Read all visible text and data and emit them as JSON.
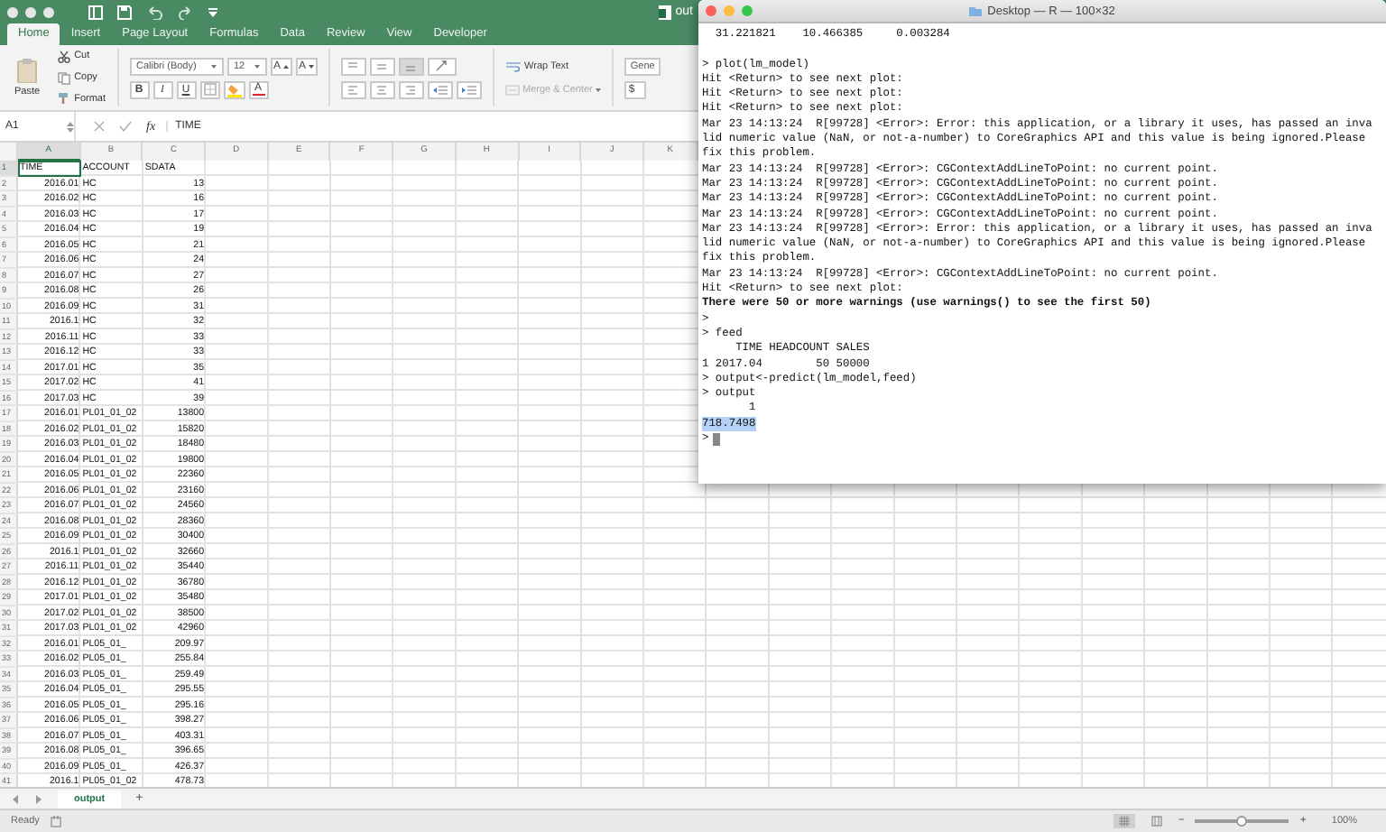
{
  "excel": {
    "title": "out",
    "tabs": [
      {
        "label": "Home",
        "selected": true
      },
      {
        "label": "Insert",
        "selected": false
      },
      {
        "label": "Page Layout",
        "selected": false
      },
      {
        "label": "Formulas",
        "selected": false
      },
      {
        "label": "Data",
        "selected": false
      },
      {
        "label": "Review",
        "selected": false
      },
      {
        "label": "View",
        "selected": false
      },
      {
        "label": "Developer",
        "selected": false
      }
    ],
    "ribbon": {
      "paste": "Paste",
      "cut": "Cut",
      "copy": "Copy",
      "format": "Format",
      "font_name": "Calibri (Body)",
      "font_size": "12",
      "grow_font": "A",
      "shrink_font": "A",
      "bold": "B",
      "italic": "I",
      "underline": "U",
      "font_color": "A",
      "wrap_text": "Wrap Text",
      "merge_center": "Merge & Center",
      "number_format": "Gene",
      "currency": "$"
    },
    "formula_bar": {
      "cell_ref": "A1",
      "fx": "fx",
      "value": "TIME"
    },
    "columns": [
      {
        "label": "A",
        "kind": "number",
        "selected": true
      },
      {
        "label": "B",
        "kind": "text",
        "selected": false
      },
      {
        "label": "C",
        "kind": "number",
        "selected": false
      },
      {
        "label": "D",
        "kind": "text",
        "selected": false
      },
      {
        "label": "E",
        "kind": "text",
        "selected": false
      },
      {
        "label": "F",
        "kind": "text",
        "selected": false
      },
      {
        "label": "G",
        "kind": "text",
        "selected": false
      },
      {
        "label": "H",
        "kind": "text",
        "selected": false
      },
      {
        "label": "I",
        "kind": "text",
        "selected": false
      },
      {
        "label": "J",
        "kind": "text",
        "selected": false
      },
      {
        "label": "K",
        "kind": "text",
        "selected": false
      }
    ],
    "rows": [
      {
        "number": "1",
        "kind": "header",
        "selected": true,
        "cells": [
          "TIME",
          "ACCOUNT",
          "SDATA"
        ]
      },
      {
        "number": "2",
        "kind": "data",
        "selected": false,
        "cells": [
          "2016.01",
          "HC",
          "13"
        ]
      },
      {
        "number": "3",
        "kind": "data",
        "selected": false,
        "cells": [
          "2016.02",
          "HC",
          "16"
        ]
      },
      {
        "number": "4",
        "kind": "data",
        "selected": false,
        "cells": [
          "2016.03",
          "HC",
          "17"
        ]
      },
      {
        "number": "5",
        "kind": "data",
        "selected": false,
        "cells": [
          "2016.04",
          "HC",
          "19"
        ]
      },
      {
        "number": "6",
        "kind": "data",
        "selected": false,
        "cells": [
          "2016.05",
          "HC",
          "21"
        ]
      },
      {
        "number": "7",
        "kind": "data",
        "selected": false,
        "cells": [
          "2016.06",
          "HC",
          "24"
        ]
      },
      {
        "number": "8",
        "kind": "data",
        "selected": false,
        "cells": [
          "2016.07",
          "HC",
          "27"
        ]
      },
      {
        "number": "9",
        "kind": "data",
        "selected": false,
        "cells": [
          "2016.08",
          "HC",
          "26"
        ]
      },
      {
        "number": "10",
        "kind": "data",
        "selected": false,
        "cells": [
          "2016.09",
          "HC",
          "31"
        ]
      },
      {
        "number": "11",
        "kind": "data",
        "selected": false,
        "cells": [
          "2016.1",
          "HC",
          "32"
        ]
      },
      {
        "number": "12",
        "kind": "data",
        "selected": false,
        "cells": [
          "2016.11",
          "HC",
          "33"
        ]
      },
      {
        "number": "13",
        "kind": "data",
        "selected": false,
        "cells": [
          "2016.12",
          "HC",
          "33"
        ]
      },
      {
        "number": "14",
        "kind": "data",
        "selected": false,
        "cells": [
          "2017.01",
          "HC",
          "35"
        ]
      },
      {
        "number": "15",
        "kind": "data",
        "selected": false,
        "cells": [
          "2017.02",
          "HC",
          "41"
        ]
      },
      {
        "number": "16",
        "kind": "data",
        "selected": false,
        "cells": [
          "2017.03",
          "HC",
          "39"
        ]
      },
      {
        "number": "17",
        "kind": "data",
        "selected": false,
        "cells": [
          "2016.01",
          "PL01_01_02",
          "13800"
        ]
      },
      {
        "number": "18",
        "kind": "data",
        "selected": false,
        "cells": [
          "2016.02",
          "PL01_01_02",
          "15820"
        ]
      },
      {
        "number": "19",
        "kind": "data",
        "selected": false,
        "cells": [
          "2016.03",
          "PL01_01_02",
          "18480"
        ]
      },
      {
        "number": "20",
        "kind": "data",
        "selected": false,
        "cells": [
          "2016.04",
          "PL01_01_02",
          "19800"
        ]
      },
      {
        "number": "21",
        "kind": "data",
        "selected": false,
        "cells": [
          "2016.05",
          "PL01_01_02",
          "22360"
        ]
      },
      {
        "number": "22",
        "kind": "data",
        "selected": false,
        "cells": [
          "2016.06",
          "PL01_01_02",
          "23160"
        ]
      },
      {
        "number": "23",
        "kind": "data",
        "selected": false,
        "cells": [
          "2016.07",
          "PL01_01_02",
          "24560"
        ]
      },
      {
        "number": "24",
        "kind": "data",
        "selected": false,
        "cells": [
          "2016.08",
          "PL01_01_02",
          "28360"
        ]
      },
      {
        "number": "25",
        "kind": "data",
        "selected": false,
        "cells": [
          "2016.09",
          "PL01_01_02",
          "30400"
        ]
      },
      {
        "number": "26",
        "kind": "data",
        "selected": false,
        "cells": [
          "2016.1",
          "PL01_01_02",
          "32660"
        ]
      },
      {
        "number": "27",
        "kind": "data",
        "selected": false,
        "cells": [
          "2016.11",
          "PL01_01_02",
          "35440"
        ]
      },
      {
        "number": "28",
        "kind": "data",
        "selected": false,
        "cells": [
          "2016.12",
          "PL01_01_02",
          "36780"
        ]
      },
      {
        "number": "29",
        "kind": "data",
        "selected": false,
        "cells": [
          "2017.01",
          "PL01_01_02",
          "35480"
        ]
      },
      {
        "number": "30",
        "kind": "data",
        "selected": false,
        "cells": [
          "2017.02",
          "PL01_01_02",
          "38500"
        ]
      },
      {
        "number": "31",
        "kind": "data",
        "selected": false,
        "cells": [
          "2017.03",
          "PL01_01_02",
          "42960"
        ]
      },
      {
        "number": "32",
        "kind": "data",
        "selected": false,
        "cells": [
          "2016.01",
          "PL05_01_",
          "209.97"
        ]
      },
      {
        "number": "33",
        "kind": "data",
        "selected": false,
        "cells": [
          "2016.02",
          "PL05_01_",
          "255.84"
        ]
      },
      {
        "number": "34",
        "kind": "data",
        "selected": false,
        "cells": [
          "2016.03",
          "PL05_01_",
          "259.49"
        ]
      },
      {
        "number": "35",
        "kind": "data",
        "selected": false,
        "cells": [
          "2016.04",
          "PL05_01_",
          "295.55"
        ]
      },
      {
        "number": "36",
        "kind": "data",
        "selected": false,
        "cells": [
          "2016.05",
          "PL05_01_",
          "295.16"
        ]
      },
      {
        "number": "37",
        "kind": "data",
        "selected": false,
        "cells": [
          "2016.06",
          "PL05_01_",
          "398.27"
        ]
      },
      {
        "number": "38",
        "kind": "data",
        "selected": false,
        "cells": [
          "2016.07",
          "PL05_01_",
          "403.31"
        ]
      },
      {
        "number": "39",
        "kind": "data",
        "selected": false,
        "cells": [
          "2016.08",
          "PL05_01_",
          "396.65"
        ]
      },
      {
        "number": "40",
        "kind": "data",
        "selected": false,
        "cells": [
          "2016.09",
          "PL05_01_",
          "426.37"
        ]
      },
      {
        "number": "41",
        "kind": "data",
        "selected": false,
        "cells": [
          "2016.1",
          "PL05_01_02",
          "478.73"
        ]
      }
    ],
    "sheet_tabs": [
      {
        "label": "output",
        "selected": true
      }
    ],
    "add_sheet": "+",
    "status": "Ready",
    "zoom": {
      "minus": "−",
      "plus": "+",
      "level": 0.5,
      "reading": "100%"
    }
  },
  "terminal": {
    "title": "Desktop — R — 100×32",
    "lines": [
      {
        "kind": "normal",
        "text": "  31.221821    10.466385     0.003284"
      },
      {
        "kind": "blank"
      },
      {
        "kind": "normal",
        "text": "> plot(lm_model)"
      },
      {
        "kind": "normal",
        "text": "Hit <Return> to see next plot:"
      },
      {
        "kind": "normal",
        "text": "Hit <Return> to see next plot:"
      },
      {
        "kind": "normal",
        "text": "Hit <Return> to see next plot:"
      },
      {
        "kind": "normal",
        "text": "Mar 23 14:13:24  R[99728] <Error>: Error: this application, or a library it uses, has passed an inva"
      },
      {
        "kind": "normal",
        "text": "lid numeric value (NaN, or not-a-number) to CoreGraphics API and this value is being ignored.Please"
      },
      {
        "kind": "normal",
        "text": "fix this problem."
      },
      {
        "kind": "normal",
        "text": "Mar 23 14:13:24  R[99728] <Error>: CGContextAddLineToPoint: no current point."
      },
      {
        "kind": "normal",
        "text": "Mar 23 14:13:24  R[99728] <Error>: CGContextAddLineToPoint: no current point."
      },
      {
        "kind": "normal",
        "text": "Mar 23 14:13:24  R[99728] <Error>: CGContextAddLineToPoint: no current point."
      },
      {
        "kind": "normal",
        "text": "Mar 23 14:13:24  R[99728] <Error>: CGContextAddLineToPoint: no current point."
      },
      {
        "kind": "normal",
        "text": "Mar 23 14:13:24  R[99728] <Error>: Error: this application, or a library it uses, has passed an inva"
      },
      {
        "kind": "normal",
        "text": "lid numeric value (NaN, or not-a-number) to CoreGraphics API and this value is being ignored.Please"
      },
      {
        "kind": "normal",
        "text": "fix this problem."
      },
      {
        "kind": "normal",
        "text": "Mar 23 14:13:24  R[99728] <Error>: CGContextAddLineToPoint: no current point."
      },
      {
        "kind": "normal",
        "text": "Hit <Return> to see next plot:"
      },
      {
        "kind": "bold",
        "text": "There were 50 or more warnings (use warnings() to see the first 50)"
      },
      {
        "kind": "normal",
        "text": ">"
      },
      {
        "kind": "normal",
        "text": "> feed"
      },
      {
        "kind": "normal",
        "text": "     TIME HEADCOUNT SALES"
      },
      {
        "kind": "normal",
        "text": "1 2017.04        50 50000"
      },
      {
        "kind": "normal",
        "text": "> output<-predict(lm_model,feed)"
      },
      {
        "kind": "normal",
        "text": "> output"
      },
      {
        "kind": "normal",
        "text": "       1"
      },
      {
        "kind": "selected",
        "text": "718.7498"
      },
      {
        "kind": "prompt",
        "text": ">"
      }
    ]
  }
}
